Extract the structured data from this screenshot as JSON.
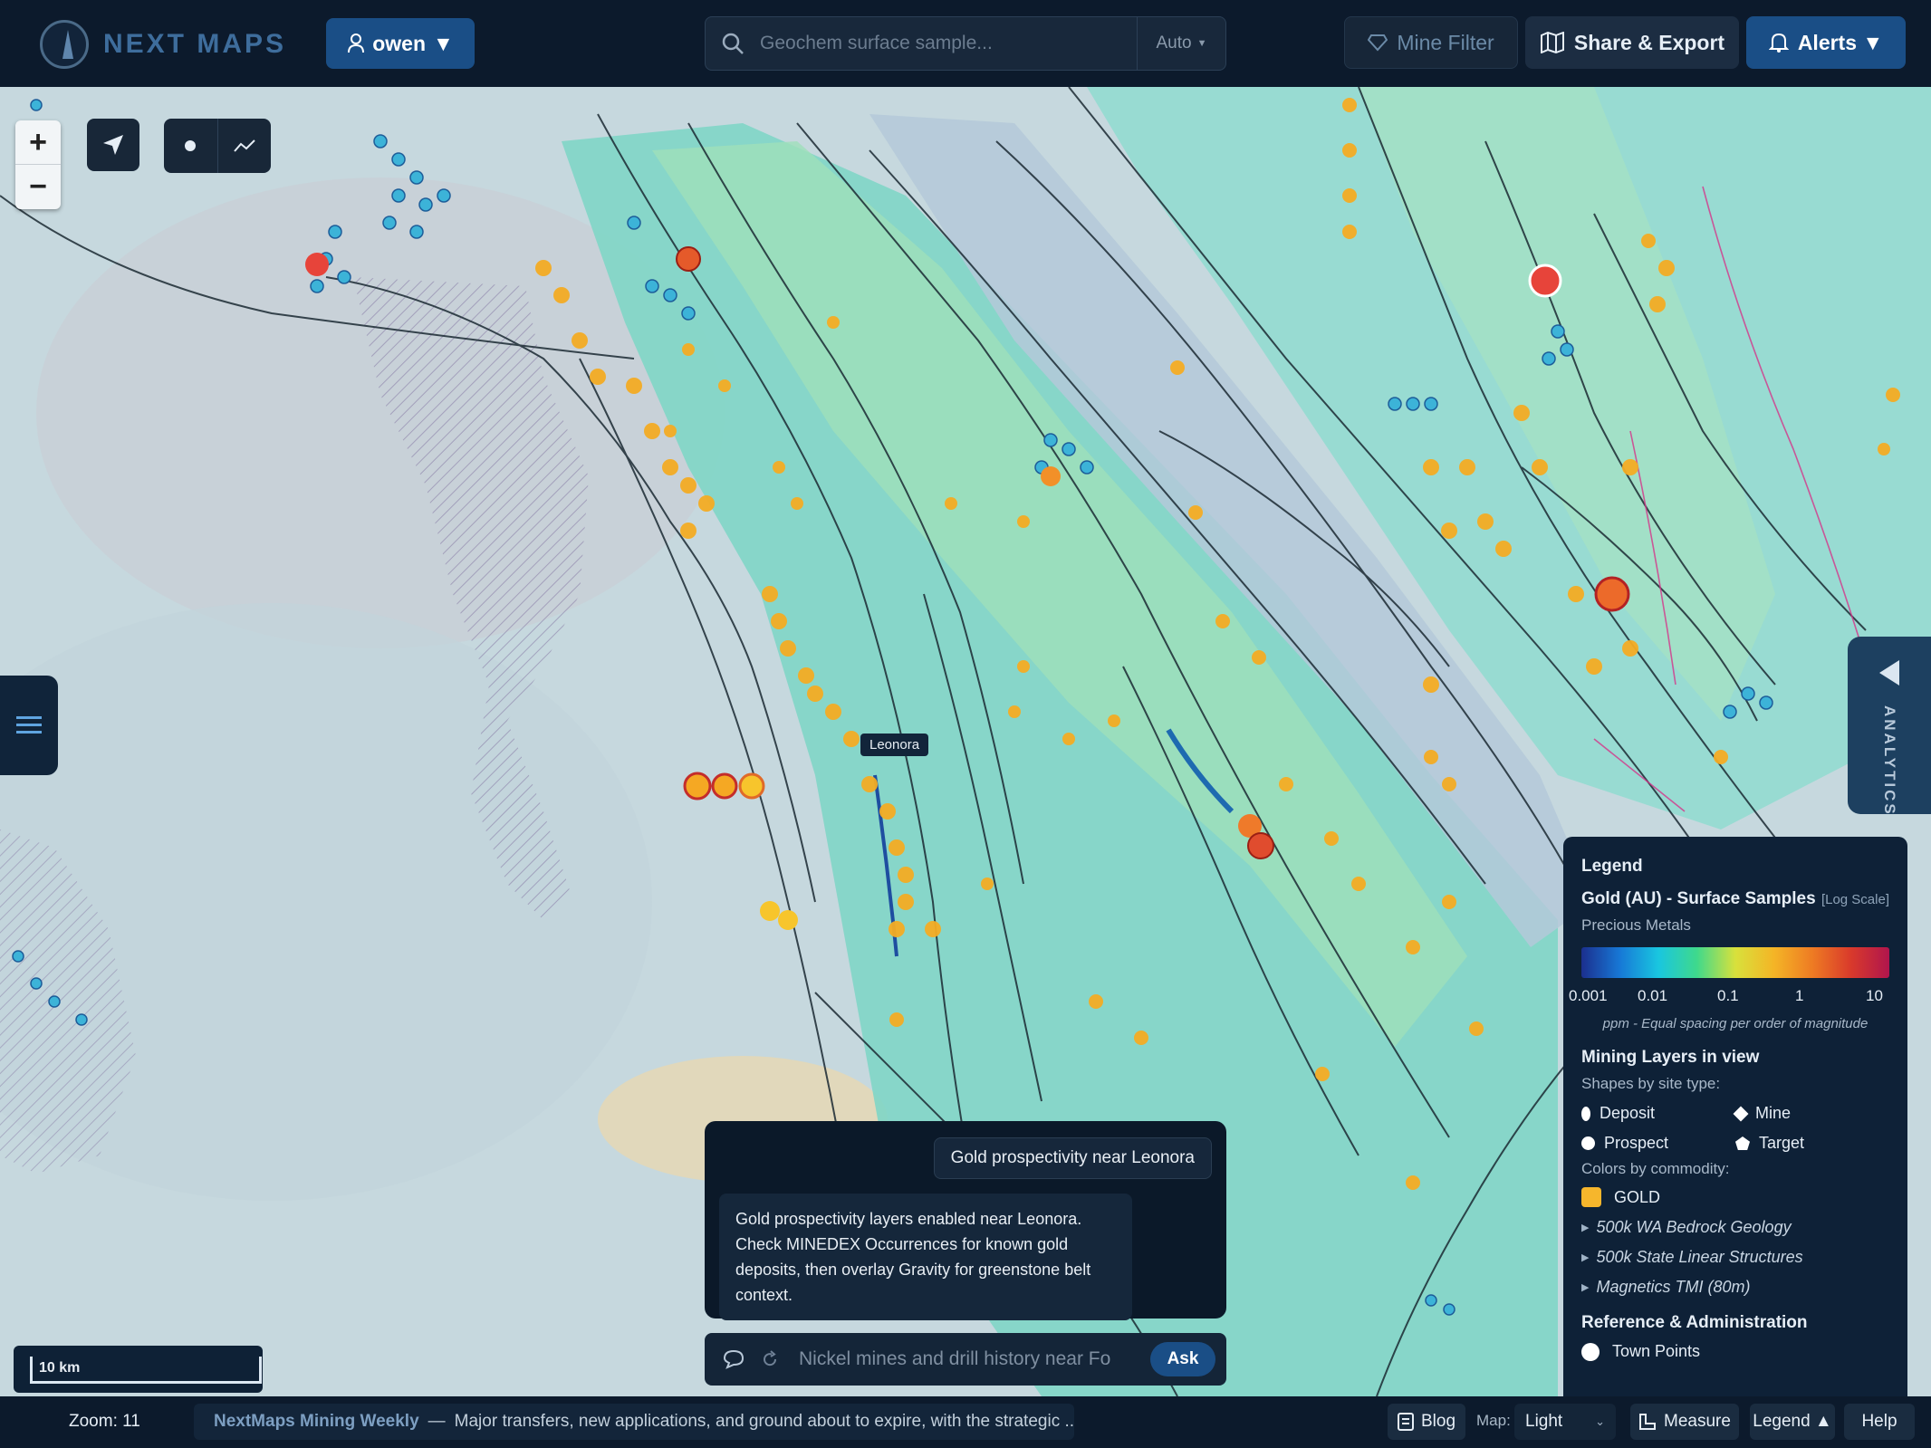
{
  "brand": {
    "name": "NEXT MAPS"
  },
  "user": {
    "name": "owen",
    "caret": "▼"
  },
  "search": {
    "placeholder": "Geochem surface sample...",
    "mode": "Auto"
  },
  "header": {
    "mine_filter": "Mine Filter",
    "share_export": "Share & Export",
    "alerts": "Alerts ▼"
  },
  "map": {
    "town_label": "Leonora",
    "scale": "10 km",
    "analytics_label": "ANALYTICS"
  },
  "legend": {
    "title": "Legend",
    "layer_name": "Gold (AU) - Surface Samples",
    "layer_scale": "[Log Scale]",
    "layer_group": "Precious Metals",
    "ticks": [
      "0.001",
      "0.01",
      "0.1",
      "1",
      "10"
    ],
    "note": "ppm - Equal spacing per order of magnitude",
    "mining_title": "Mining Layers in view",
    "shapes_caption": "Shapes by site type:",
    "site_types": {
      "deposit": "Deposit",
      "mine": "Mine",
      "prospect": "Prospect",
      "target": "Target"
    },
    "colors_caption": "Colors by commodity:",
    "commodity": "GOLD",
    "layers": [
      "500k WA Bedrock Geology",
      "500k State Linear Structures",
      "Magnetics TMI (80m)"
    ],
    "ref_title": "Reference & Administration",
    "town_points": "Town Points"
  },
  "chat": {
    "user_message": "Gold prospectivity near Leonora",
    "bot_message": "Gold prospectivity layers enabled near Leonora. Check MINEDEX Occurrences for known gold deposits, then overlay Gravity for greenstone belt context.",
    "input_placeholder": "Nickel mines and drill history near Fo",
    "ask": "Ask"
  },
  "footer": {
    "zoom": "Zoom: 11",
    "news_source": "NextMaps Mining Weekly",
    "news_sep": "—",
    "news_text": "Major transfers, new applications, and ground about to expire, with the strategic ...",
    "news_arrow": "→",
    "blog": "Blog",
    "map_label": "Map:",
    "map_style": "Light",
    "measure": "Measure",
    "legend": "Legend ▲",
    "help": "Help"
  }
}
